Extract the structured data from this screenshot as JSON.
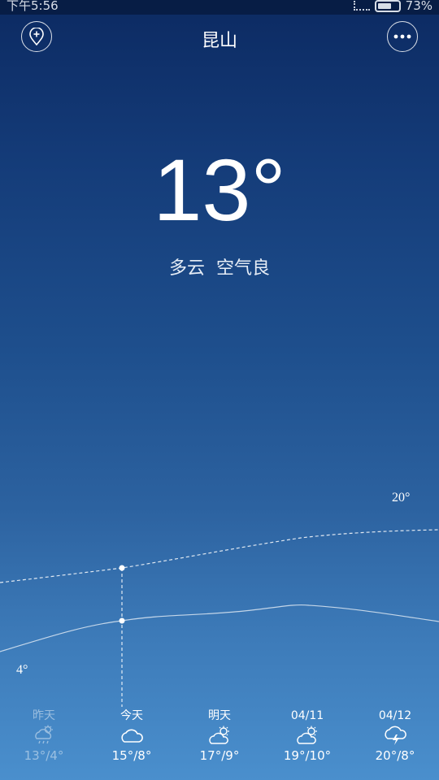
{
  "status_bar": {
    "time": "下午5:56",
    "battery": "73%",
    "battery_level": 0.73
  },
  "header": {
    "city": "昆山",
    "add_icon": "location-add-icon",
    "more_icon": "more-dots-icon"
  },
  "current": {
    "temperature": "13°",
    "condition": "多云",
    "air_quality": "空气良"
  },
  "chart": {
    "high_label": "20°",
    "low_label": "4°"
  },
  "forecast": [
    {
      "day": "昨天",
      "icon": "rain-cloud-icon",
      "high": "13°",
      "low": "/4°"
    },
    {
      "day": "今天",
      "icon": "cloud-icon",
      "high": "15°",
      "low": "/8°"
    },
    {
      "day": "明天",
      "icon": "partly-cloudy-icon",
      "high": "17°",
      "low": "/9°"
    },
    {
      "day": "04/11",
      "icon": "partly-cloudy-icon",
      "high": "19°",
      "low": "/10°"
    },
    {
      "day": "04/12",
      "icon": "thunderstorm-icon",
      "high": "20°",
      "low": "/8°"
    }
  ]
}
